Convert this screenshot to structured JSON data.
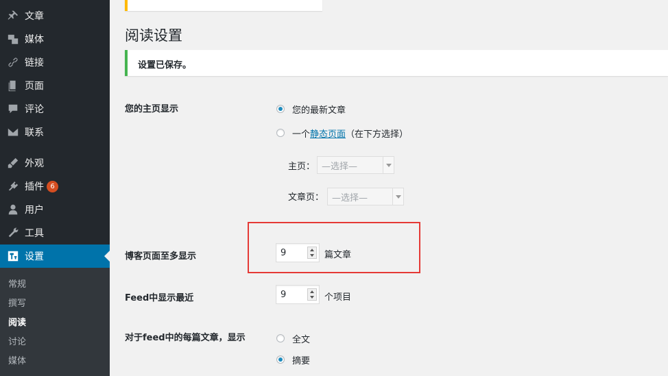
{
  "sidebar": {
    "items": [
      {
        "label": "文章",
        "icon": "pin-icon"
      },
      {
        "label": "媒体",
        "icon": "media-icon"
      },
      {
        "label": "链接",
        "icon": "link-icon"
      },
      {
        "label": "页面",
        "icon": "page-icon"
      },
      {
        "label": "评论",
        "icon": "comment-icon"
      },
      {
        "label": "联系",
        "icon": "mail-icon"
      },
      {
        "label": "外观",
        "icon": "brush-icon"
      },
      {
        "label": "插件",
        "icon": "plugin-icon",
        "badge": "6"
      },
      {
        "label": "用户",
        "icon": "user-icon"
      },
      {
        "label": "工具",
        "icon": "wrench-icon"
      },
      {
        "label": "设置",
        "icon": "settings-icon",
        "active": true
      }
    ],
    "submenu": [
      "常规",
      "撰写",
      "阅读",
      "讨论",
      "媒体"
    ],
    "submenu_current": "阅读"
  },
  "page": {
    "title": "阅读设置",
    "saved_notice": "设置已保存。"
  },
  "homepage_display": {
    "label": "您的主页显示",
    "option_latest": "您的最新文章",
    "option_static_prefix": "一个",
    "option_static_link": "静态页面",
    "option_static_suffix": "（在下方选择）",
    "selected": "latest",
    "front_page_label": "主页：",
    "front_page_value": "—选择—",
    "posts_page_label": "文章页：",
    "posts_page_value": "—选择—"
  },
  "posts_per_page": {
    "label": "博客页面至多显示",
    "value": "9",
    "unit": "篇文章"
  },
  "feed_items": {
    "label": "Feed中显示最近",
    "value": "9",
    "unit": "个项目"
  },
  "feed_content": {
    "label": "对于feed中的每篇文章，显示",
    "option_full": "全文",
    "option_summary": "摘要",
    "selected": "summary"
  },
  "colors": {
    "sidebar_bg": "#23282d",
    "active_bg": "#0073aa",
    "success_border": "#46b450",
    "warning_border": "#ffb900",
    "highlight_border": "#e53935"
  }
}
